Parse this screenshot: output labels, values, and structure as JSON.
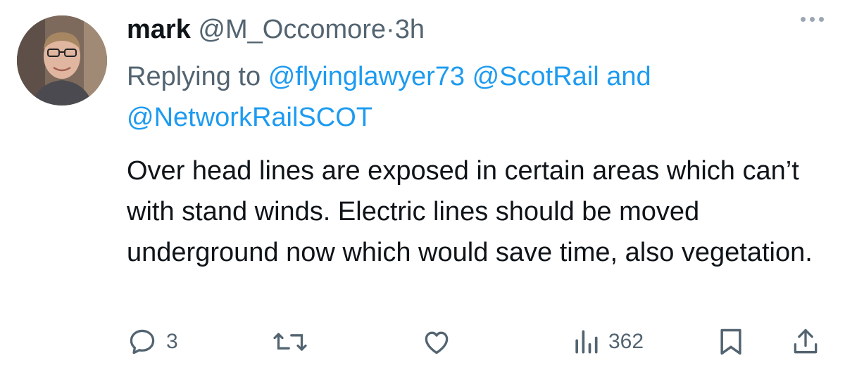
{
  "tweet": {
    "author_name": "mark",
    "handle": "@M_Occomore",
    "separator": "·",
    "time": "3h",
    "replying_prefix": "Replying to",
    "mentions": [
      "@flyinglawyer73",
      "@ScotRail",
      "@NetworkRailSCOT"
    ],
    "mention_joiner": "and",
    "text": "Over head lines are exposed in certain areas which can’t with stand winds. Electric lines should be moved  underground now which would save time, also vegetation.",
    "counts": {
      "replies": "3",
      "views": "362"
    }
  },
  "icons": {
    "more": "more-dots-icon",
    "reply": "reply-bubble-icon",
    "retweet": "retweet-icon",
    "like": "heart-icon",
    "views": "views-bars-icon",
    "bookmark": "bookmark-icon",
    "share": "share-icon"
  },
  "colors": {
    "primary_text": "#0f1419",
    "secondary_text": "#536471",
    "link": "#1d9bf0",
    "background": "#ffffff"
  }
}
